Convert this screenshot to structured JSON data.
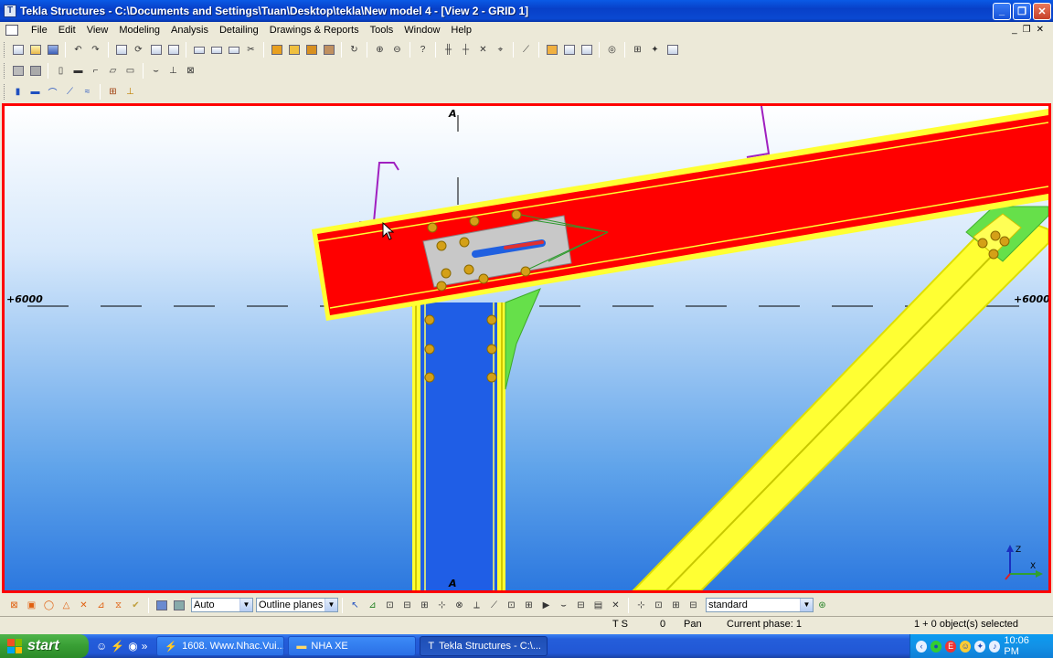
{
  "window": {
    "title": "Tekla Structures - C:\\Documents and Settings\\Tuan\\Desktop\\tekla\\New model 4 - [View 2 - GRID 1]",
    "minimize_glyph": "_",
    "restore_glyph": "❐",
    "close_glyph": "✕"
  },
  "menu": {
    "items": [
      "File",
      "Edit",
      "View",
      "Modeling",
      "Analysis",
      "Detailing",
      "Drawings & Reports",
      "Tools",
      "Window",
      "Help"
    ],
    "doc_controls": [
      "_",
      "❐",
      "✕"
    ]
  },
  "viewport": {
    "grid_label_top": "A",
    "grid_label_bottom": "A",
    "level_left": "+6000",
    "level_right": "+6000",
    "colors": {
      "frame": "#ff0000",
      "beam": "#ff0000",
      "beam_outline": "#ffff00",
      "column": "#1f5ee6",
      "brace": "#ffff00",
      "stiffener": "#33cc33",
      "plate": "#c8c8c8",
      "bolt": "#d4a017"
    }
  },
  "bottom_toolbar": {
    "work_plane_select": "Auto",
    "view_planes_select": "Outline planes",
    "filter_select": "standard"
  },
  "status": {
    "ts": "T S",
    "count": "0",
    "mode": "Pan",
    "phase": "Current phase: 1",
    "selection": "1 + 0 object(s) selected"
  },
  "taskbar": {
    "start_label": "start",
    "quick_more": "»",
    "tasks": [
      {
        "label": "1608. Www.Nhac.Vui...",
        "icon": "winamp-icon"
      },
      {
        "label": "NHA XE",
        "icon": "folder-icon"
      },
      {
        "label": "Tekla Structures - C:\\...",
        "icon": "tekla-icon"
      }
    ],
    "clock": "10:06 PM"
  }
}
